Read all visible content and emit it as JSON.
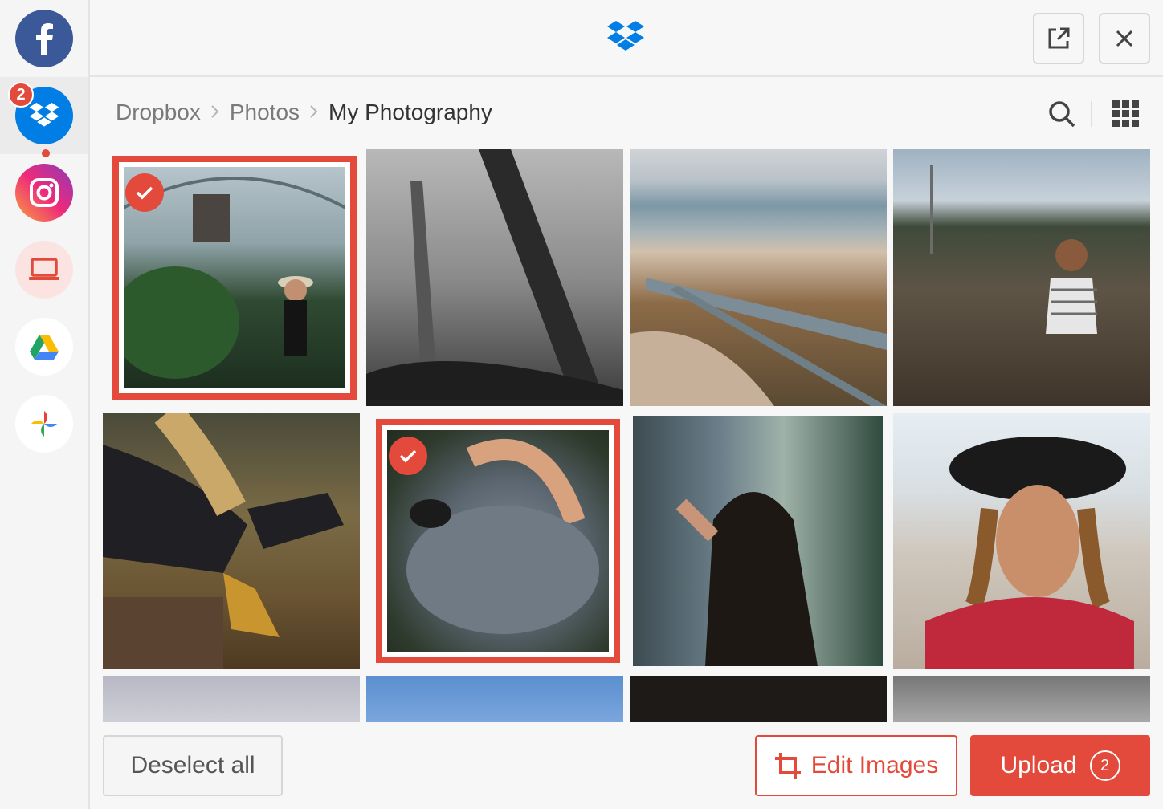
{
  "sidebar": {
    "sources": [
      {
        "name": "facebook",
        "icon": "facebook-icon",
        "color": "#3b5998"
      },
      {
        "name": "dropbox",
        "icon": "dropbox-icon",
        "color": "#007ee5",
        "badge": "2",
        "active": true
      },
      {
        "name": "instagram",
        "icon": "instagram-icon"
      },
      {
        "name": "device",
        "icon": "laptop-icon",
        "color": "#e34a3b"
      },
      {
        "name": "google-drive",
        "icon": "google-drive-icon"
      },
      {
        "name": "google-photos",
        "icon": "google-photos-icon"
      }
    ]
  },
  "header": {
    "logo_icon": "dropbox-logo-icon",
    "popout_icon": "external-link-icon",
    "close_icon": "close-icon"
  },
  "breadcrumb": {
    "items": [
      "Dropbox",
      "Photos",
      "My Photography"
    ],
    "separator": ">"
  },
  "toolbar": {
    "search_icon": "search-icon",
    "grid_icon": "grid-view-icon"
  },
  "photos": [
    {
      "id": "greenhouse-woman",
      "selected": true
    },
    {
      "id": "foggy-forest",
      "selected": false
    },
    {
      "id": "beach-fence",
      "selected": false
    },
    {
      "id": "field-woman",
      "selected": false
    },
    {
      "id": "sitting-boots",
      "selected": false
    },
    {
      "id": "dog-petting",
      "selected": true
    },
    {
      "id": "woman-back",
      "selected": false
    },
    {
      "id": "woman-hat",
      "selected": false
    },
    {
      "id": "sky-pale",
      "selected": false
    },
    {
      "id": "sky-blue",
      "selected": false
    },
    {
      "id": "dark",
      "selected": false
    },
    {
      "id": "grey-clouds",
      "selected": false
    }
  ],
  "footer": {
    "deselect_label": "Deselect all",
    "edit_label": "Edit Images",
    "upload_label": "Upload",
    "upload_count": "2"
  },
  "colors": {
    "accent": "#e34a3b",
    "dropbox": "#007ee5",
    "facebook": "#3b5998"
  }
}
